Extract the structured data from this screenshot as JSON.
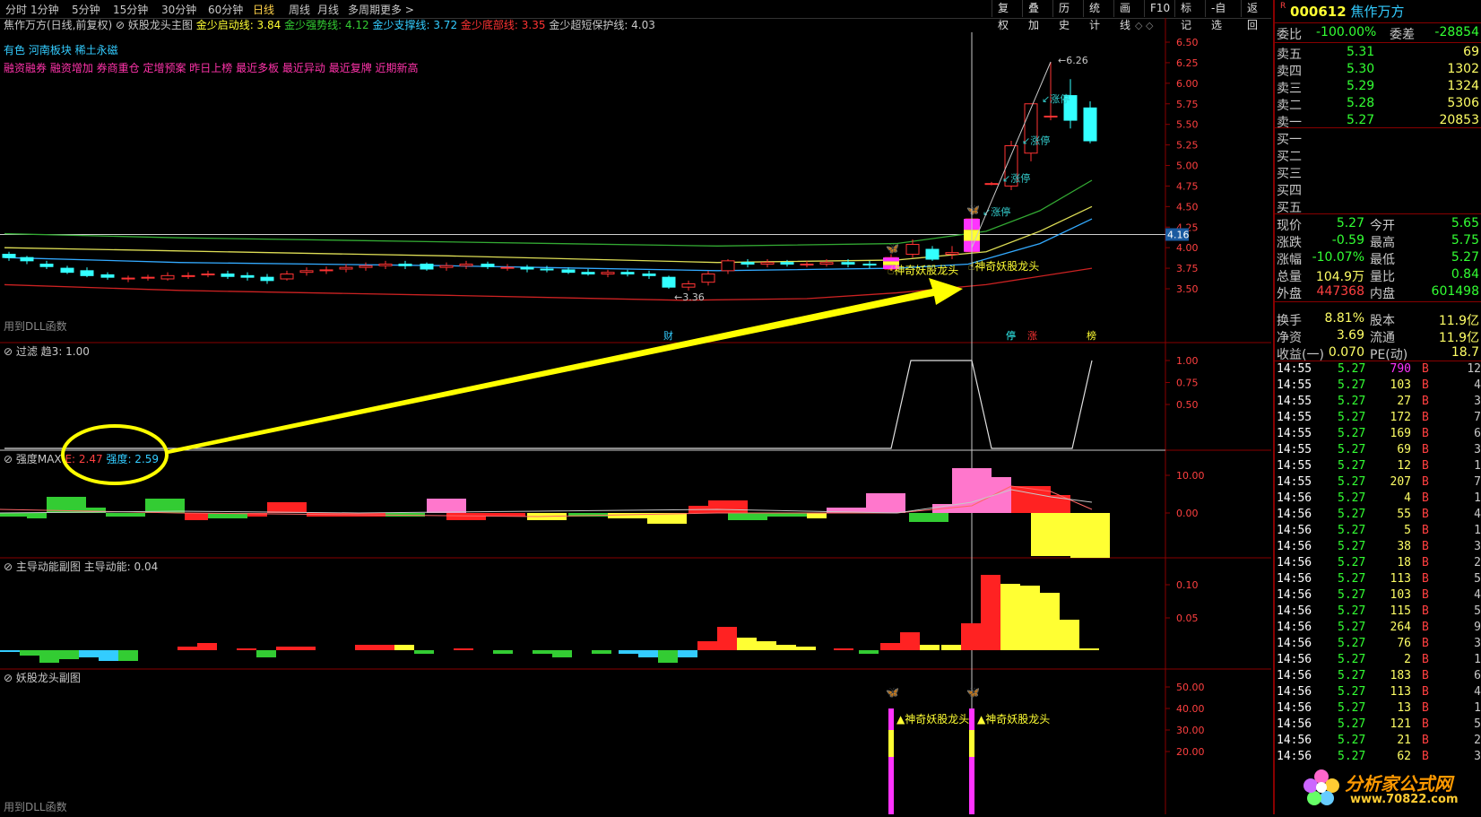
{
  "toolbar": {
    "timeframes": [
      "分时",
      "1分钟",
      "5分钟",
      "15分钟",
      "30分钟",
      "60分钟",
      "日线",
      "周线",
      "月线",
      "多周期",
      "更多 >"
    ],
    "selected_timeframe": "日线",
    "right_buttons": [
      "复权",
      "叠加",
      "历史",
      "统计",
      "画线",
      "F10",
      "标记",
      "-自选",
      "返回"
    ]
  },
  "main_chart": {
    "title": "焦作万方(日线,前复权)",
    "indicator_name": "妖股龙头主图",
    "lines": [
      {
        "label": "金少启动线:",
        "value": "3.84",
        "color": "#ffff33"
      },
      {
        "label": "金少强势线:",
        "value": "4.12",
        "color": "#33cc33"
      },
      {
        "label": "金少支撑线:",
        "value": "3.72",
        "color": "#33ccff"
      },
      {
        "label": "金少底部线:",
        "value": "3.35",
        "color": "#ff3333"
      },
      {
        "label": "金少超短保护线:",
        "value": "4.03",
        "color": "#c8c8c8"
      }
    ],
    "concepts_line1": "有色 河南板块 稀土永磁",
    "concepts_line2": "融资融券 融资增加 券商重仓 定增预案 昨日上榜 最近多板 最近异动 最近复牌 近期新高",
    "dll_note": "用到DLL函数",
    "y_ticks": [
      "6.50",
      "6.25",
      "6.00",
      "5.75",
      "5.50",
      "5.25",
      "5.00",
      "4.75",
      "4.50",
      "4.25",
      "4.00",
      "3.75",
      "3.50"
    ],
    "price_tag": "4.16",
    "high_label": "6.26",
    "low_label": "3.36",
    "limit_up_label": "涨停",
    "signal_label": "神奇妖股龙头",
    "markers": {
      "cai": "财",
      "ting": "停",
      "zhang": "涨",
      "bang": "榜"
    }
  },
  "filter_panel": {
    "name": "过滤",
    "value_label": "趋3: 1.00",
    "y_ticks": [
      "1.00",
      "0.75",
      "0.50"
    ]
  },
  "strength_panel": {
    "name": "强度MAX",
    "e_label": "E: 2.47",
    "strength_label": "强度: 2.59",
    "y_ticks": [
      "10.00",
      "0.00"
    ]
  },
  "momentum_panel": {
    "name": "主导动能副图",
    "value_label": "主导动能: 0.04",
    "y_ticks": [
      "0.10",
      "0.05"
    ]
  },
  "sub_panel": {
    "name": "妖股龙头副图",
    "signal_label": "▲神奇妖股龙头",
    "dll_note": "用到DLL函数",
    "y_ticks": [
      "50.00",
      "40.00",
      "30.00",
      "20.00"
    ]
  },
  "quote": {
    "code": "000612",
    "name": "焦作万方",
    "weibi_label": "委比",
    "weibi_value": "-100.00%",
    "weicha_label": "委差",
    "weicha_value": "-28854",
    "asks": [
      {
        "label": "卖五",
        "price": "5.31",
        "vol": "69"
      },
      {
        "label": "卖四",
        "price": "5.30",
        "vol": "1302"
      },
      {
        "label": "卖三",
        "price": "5.29",
        "vol": "1324"
      },
      {
        "label": "卖二",
        "price": "5.28",
        "vol": "5306"
      },
      {
        "label": "卖一",
        "price": "5.27",
        "vol": "20853"
      }
    ],
    "bids": [
      "买一",
      "买二",
      "买三",
      "买四",
      "买五"
    ],
    "stats": [
      {
        "l1": "现价",
        "v1": "5.27",
        "c1": "#33ff33",
        "l2": "今开",
        "v2": "5.65",
        "c2": "#33ff33"
      },
      {
        "l1": "涨跌",
        "v1": "-0.59",
        "c1": "#33ff33",
        "l2": "最高",
        "v2": "5.75",
        "c2": "#33ff33"
      },
      {
        "l1": "涨幅",
        "v1": "-10.07%",
        "c1": "#33ff33",
        "l2": "最低",
        "v2": "5.27",
        "c2": "#33ff33"
      },
      {
        "l1": "总量",
        "v1": "104.9万",
        "c1": "#ffff66",
        "l2": "量比",
        "v2": "0.84",
        "c2": "#33ff33"
      },
      {
        "l1": "外盘",
        "v1": "447368",
        "c1": "#ff4040",
        "l2": "内盘",
        "v2": "601498",
        "c2": "#33ff33"
      },
      {
        "l1": "换手",
        "v1": "8.81%",
        "c1": "#ffff66",
        "l2": "股本",
        "v2": "11.9亿",
        "c2": "#ffff66"
      },
      {
        "l1": "净资",
        "v1": "3.69",
        "c1": "#ffff66",
        "l2": "流通",
        "v2": "11.9亿",
        "c2": "#ffff66"
      },
      {
        "l1": "收益(一)",
        "v1": "0.070",
        "c1": "#ffff66",
        "l2": "PE(动)",
        "v2": "18.7",
        "c2": "#ffff66"
      }
    ],
    "ticks": [
      {
        "t": "14:55",
        "p": "5.27",
        "v": "790",
        "vc": "#ff33ff",
        "s": "B",
        "n": "12"
      },
      {
        "t": "14:55",
        "p": "5.27",
        "v": "103",
        "vc": "#ffff66",
        "s": "B",
        "n": "4"
      },
      {
        "t": "14:55",
        "p": "5.27",
        "v": "27",
        "vc": "#ffff66",
        "s": "B",
        "n": "3"
      },
      {
        "t": "14:55",
        "p": "5.27",
        "v": "172",
        "vc": "#ffff66",
        "s": "B",
        "n": "7"
      },
      {
        "t": "14:55",
        "p": "5.27",
        "v": "169",
        "vc": "#ffff66",
        "s": "B",
        "n": "6"
      },
      {
        "t": "14:55",
        "p": "5.27",
        "v": "69",
        "vc": "#ffff66",
        "s": "B",
        "n": "3"
      },
      {
        "t": "14:55",
        "p": "5.27",
        "v": "12",
        "vc": "#ffff66",
        "s": "B",
        "n": "1"
      },
      {
        "t": "14:55",
        "p": "5.27",
        "v": "207",
        "vc": "#ffff66",
        "s": "B",
        "n": "7"
      },
      {
        "t": "14:56",
        "p": "5.27",
        "v": "4",
        "vc": "#ffff66",
        "s": "B",
        "n": "1"
      },
      {
        "t": "14:56",
        "p": "5.27",
        "v": "55",
        "vc": "#ffff66",
        "s": "B",
        "n": "4"
      },
      {
        "t": "14:56",
        "p": "5.27",
        "v": "5",
        "vc": "#ffff66",
        "s": "B",
        "n": "1"
      },
      {
        "t": "14:56",
        "p": "5.27",
        "v": "38",
        "vc": "#ffff66",
        "s": "B",
        "n": "3"
      },
      {
        "t": "14:56",
        "p": "5.27",
        "v": "18",
        "vc": "#ffff66",
        "s": "B",
        "n": "2"
      },
      {
        "t": "14:56",
        "p": "5.27",
        "v": "113",
        "vc": "#ffff66",
        "s": "B",
        "n": "5"
      },
      {
        "t": "14:56",
        "p": "5.27",
        "v": "103",
        "vc": "#ffff66",
        "s": "B",
        "n": "4"
      },
      {
        "t": "14:56",
        "p": "5.27",
        "v": "115",
        "vc": "#ffff66",
        "s": "B",
        "n": "5"
      },
      {
        "t": "14:56",
        "p": "5.27",
        "v": "264",
        "vc": "#ffff66",
        "s": "B",
        "n": "9"
      },
      {
        "t": "14:56",
        "p": "5.27",
        "v": "76",
        "vc": "#ffff66",
        "s": "B",
        "n": "3"
      },
      {
        "t": "14:56",
        "p": "5.27",
        "v": "2",
        "vc": "#ffff66",
        "s": "B",
        "n": "1"
      },
      {
        "t": "14:56",
        "p": "5.27",
        "v": "183",
        "vc": "#ffff66",
        "s": "B",
        "n": "6"
      },
      {
        "t": "14:56",
        "p": "5.27",
        "v": "113",
        "vc": "#ffff66",
        "s": "B",
        "n": "4"
      },
      {
        "t": "14:56",
        "p": "5.27",
        "v": "13",
        "vc": "#ffff66",
        "s": "B",
        "n": "1"
      },
      {
        "t": "14:56",
        "p": "5.27",
        "v": "121",
        "vc": "#ffff66",
        "s": "B",
        "n": "5"
      },
      {
        "t": "14:56",
        "p": "5.27",
        "v": "21",
        "vc": "#ffff66",
        "s": "B",
        "n": "2"
      },
      {
        "t": "14:56",
        "p": "5.27",
        "v": "62",
        "vc": "#ffff66",
        "s": "B",
        "n": "3"
      }
    ]
  },
  "watermark": {
    "text": "分析家公式网",
    "url": "www.70822.com"
  },
  "colors": {
    "up": "#ff3333",
    "down": "#33ffff",
    "accent": "#ffff00",
    "border": "#880000"
  }
}
